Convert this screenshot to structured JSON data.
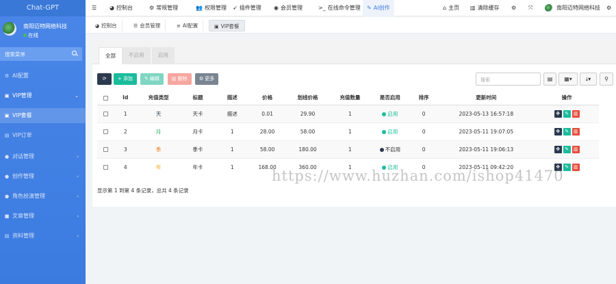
{
  "app": {
    "logo": "Chat-GPT"
  },
  "user": {
    "name": "南阳迈特网络科技",
    "status": "在线"
  },
  "sidebar": {
    "search_placeholder": "搜索菜单",
    "items": [
      {
        "label": "AI配置",
        "icon": "gear-icon"
      },
      {
        "label": "VIP管理",
        "icon": "vip-icon"
      },
      {
        "label": "VIP套餐",
        "icon": "vip-icon"
      },
      {
        "label": "VIP订单",
        "icon": "file-icon"
      },
      {
        "label": "对话管理",
        "icon": "chat-icon"
      },
      {
        "label": "创作管理",
        "icon": "chat-icon"
      },
      {
        "label": "角色扮演管理",
        "icon": "chat-icon"
      },
      {
        "label": "文章管理",
        "icon": "bookmark-icon"
      },
      {
        "label": "资料管理",
        "icon": "file-icon"
      }
    ]
  },
  "topnav": {
    "items": [
      "控制台",
      "常规管理",
      "权限管理",
      "插件管理",
      "会员管理",
      "在线命令管理",
      "AI创作"
    ],
    "home": "主页",
    "clear_cache": "清除缓存",
    "user_name": "南阳迈特网络科技"
  },
  "tabs": [
    "控制台",
    "会员管理",
    "AI配置",
    "VIP套餐"
  ],
  "panel": {
    "filter_tabs": [
      "全部",
      "不启用",
      "启用"
    ],
    "buttons": {
      "add": "添加",
      "edit": "编辑",
      "delete": "删除",
      "more": "更多"
    },
    "search_placeholder": "搜索",
    "columns": [
      "Id",
      "充值类型",
      "标题",
      "描述",
      "价格",
      "划线价格",
      "充值数量",
      "是否启用",
      "排序",
      "更新时间",
      "操作"
    ],
    "rows": [
      {
        "id": "1",
        "type": "天",
        "type_class": "t-day",
        "title": "天卡",
        "desc": "描述",
        "price": "0.01",
        "orig_price": "29.90",
        "qty": "1",
        "status": "启用",
        "on": true,
        "sort": "0",
        "updated": "2023-05-13 16:57:18"
      },
      {
        "id": "2",
        "type": "月",
        "type_class": "t-month",
        "title": "月卡",
        "desc": "1",
        "price": "28.00",
        "orig_price": "58.00",
        "qty": "1",
        "status": "启用",
        "on": true,
        "sort": "0",
        "updated": "2023-05-11 19:07:05"
      },
      {
        "id": "3",
        "type": "季",
        "type_class": "t-quarter",
        "title": "季卡",
        "desc": "1",
        "price": "58.00",
        "orig_price": "180.00",
        "qty": "1",
        "status": "不启用",
        "on": false,
        "sort": "0",
        "updated": "2023-05-11 19:06:13"
      },
      {
        "id": "4",
        "type": "年",
        "type_class": "t-year",
        "title": "年卡",
        "desc": "1",
        "price": "168.00",
        "orig_price": "360.00",
        "qty": "1",
        "status": "启用",
        "on": true,
        "sort": "0",
        "updated": "2023-05-11 09:42:20"
      }
    ],
    "footer": "显示第 1 到第 4 条记录，总共 4 条记录"
  },
  "watermark": "https://www.huzhan.com/ishop41470",
  "colors": {
    "sidebar": "#4a86e8",
    "accent": "#1abc9c",
    "danger": "#e74c3c",
    "dark": "#2c3a4f"
  }
}
